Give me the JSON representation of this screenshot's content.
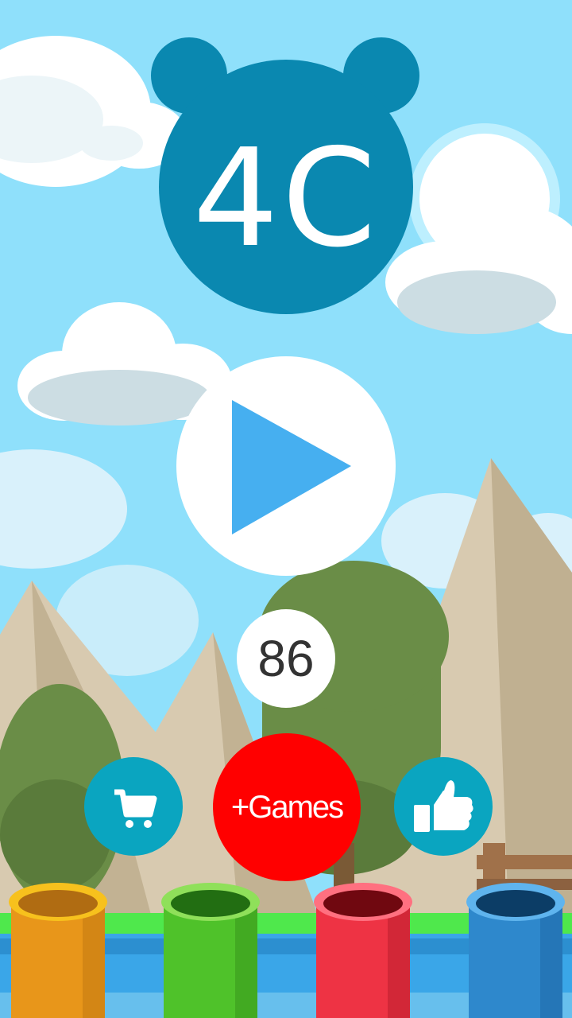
{
  "game": {
    "title": "4C",
    "score": "86",
    "more_games_label": "+Games"
  },
  "buttons": {
    "play": "play",
    "shop": "cart",
    "like": "thumbs-up"
  },
  "pipes": [
    {
      "name": "orange",
      "body": "#e8961a",
      "rim": "#f7c11d",
      "hole": "#b06c12"
    },
    {
      "name": "green",
      "body": "#4fc22a",
      "rim": "#8fe05a",
      "hole": "#226e12"
    },
    {
      "name": "red",
      "body": "#ee3344",
      "rim": "#ff7080",
      "hole": "#700810"
    },
    {
      "name": "blue",
      "body": "#2e88cc",
      "rim": "#5fb4ee",
      "hole": "#0c3d66"
    }
  ],
  "colors": {
    "sky": "#8fe0fb",
    "logo": "#0a88b0",
    "play_triangle": "#46aff0",
    "action_button": "#0aa5c0",
    "more_games": "#ff0000"
  }
}
